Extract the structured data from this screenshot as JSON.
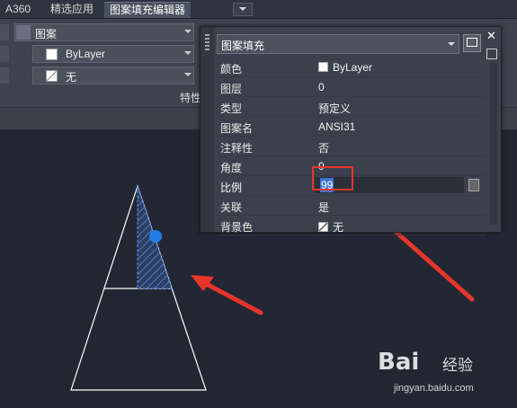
{
  "tabs": [
    "A360",
    "精选应用",
    "图案填充编辑器"
  ],
  "ribbon": {
    "rows": [
      {
        "label": "图案",
        "icon": "hatch-pattern-icon"
      },
      {
        "label": "ByLayer",
        "icon": "color-swatch-icon"
      },
      {
        "label": "无",
        "icon": "background-color-icon"
      }
    ],
    "panel_label": "特性"
  },
  "palette": {
    "selector": "图案填充",
    "properties": [
      {
        "name": "颜色",
        "value": "ByLayer",
        "swatch": "white"
      },
      {
        "name": "图层",
        "value": "0"
      },
      {
        "name": "类型",
        "value": "预定义"
      },
      {
        "name": "图案名",
        "value": "ANSI31"
      },
      {
        "name": "注释性",
        "value": "否"
      },
      {
        "name": "角度",
        "value": "0"
      },
      {
        "name": "比例",
        "value": "99"
      },
      {
        "name": "关联",
        "value": "是"
      },
      {
        "name": "背景色",
        "value": "无",
        "swatch": "none"
      }
    ]
  },
  "colors": {
    "canvas": "#222733",
    "hatch": "#3a78d0",
    "grip": "#1f7fe6",
    "annotation": "#e8342a"
  },
  "watermark": {
    "main": "Bai",
    "sub": "经验",
    "url": "jingyan.baidu.com"
  }
}
